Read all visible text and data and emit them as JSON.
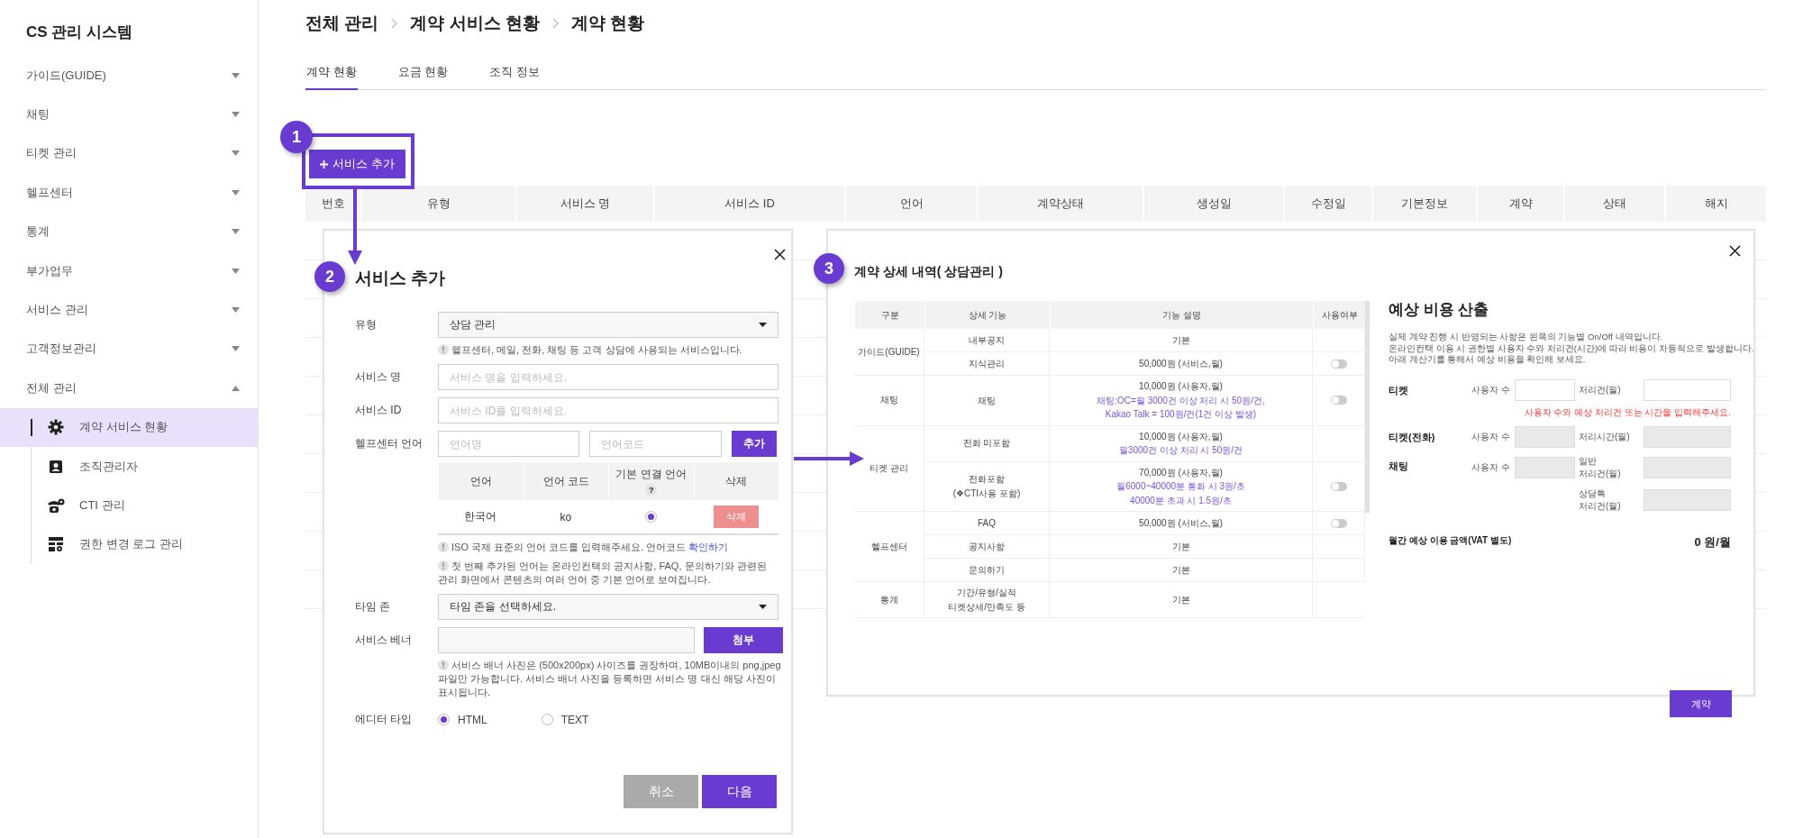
{
  "sidebar": {
    "title": "CS 관리 시스템",
    "items": [
      {
        "label": "가이드(GUIDE)",
        "expanded": false
      },
      {
        "label": "채팅",
        "expanded": false
      },
      {
        "label": "티켓 관리",
        "expanded": false
      },
      {
        "label": "헬프센터",
        "expanded": false
      },
      {
        "label": "통계",
        "expanded": false
      },
      {
        "label": "부가업무",
        "expanded": false
      },
      {
        "label": "서비스 관리",
        "expanded": false
      },
      {
        "label": "고객정보관리",
        "expanded": false
      },
      {
        "label": "전체 관리",
        "expanded": true,
        "children": [
          {
            "label": "계약 서비스 현황",
            "selected": true
          },
          {
            "label": "조직관리자",
            "selected": false
          },
          {
            "label": "CTI 관리",
            "selected": false
          },
          {
            "label": "권한 변경 로그 관리",
            "selected": false
          }
        ]
      }
    ]
  },
  "breadcrumb": [
    "전체 관리",
    "계약 서비스 현황",
    "계약 현황"
  ],
  "tabs": [
    {
      "label": "계약 현황",
      "selected": true
    },
    {
      "label": "요금 현황",
      "selected": false
    },
    {
      "label": "조직 정보",
      "selected": false
    }
  ],
  "add_button": "서비스 추가",
  "table": {
    "columns": [
      "번호",
      "유형",
      "서비스 명",
      "서비스 ID",
      "언어",
      "계약상태",
      "생성일",
      "수정일",
      "기본정보",
      "계약",
      "상태",
      "해지"
    ]
  },
  "callouts": [
    "1",
    "2",
    "3"
  ],
  "service_modal": {
    "title": "서비스 추가",
    "fields": [
      {
        "kind": "select",
        "label": "유형",
        "value": "상담 관리",
        "notes": [
          {
            "text": "헬프센터, 메일, 전화, 채팅 등 고객 상담에 사용되는 서비스입니다."
          }
        ]
      },
      {
        "kind": "text",
        "label": "서비스 명",
        "placeholder": "서비스 명을 입력하세요."
      },
      {
        "kind": "text",
        "label": "서비스 ID",
        "placeholder": "서비스 ID를 입력하세요."
      },
      {
        "kind": "language",
        "label": "헬프센터 언어",
        "name_placeholder": "언어명",
        "code_placeholder": "언어코드",
        "button": "추가",
        "columns": [
          "언어",
          "언어 코드",
          "기본 연결 언어",
          "삭제"
        ],
        "help_mark": "?",
        "rows": [
          {
            "language": "한국어",
            "code": "ko",
            "default": true,
            "delete": "삭제",
            "delete_disabled": true
          }
        ],
        "notes": [
          {
            "text": "ISO 국제 표준의 언어 코드를 입력해주세요. 언어코드",
            "link": "확인하기"
          },
          {
            "text": "첫 번째 추가된 언어는 온라인컨택의 공지사항, FAQ, 문의하기와 관련된 관리 화면에서 콘텐츠의 여러 언어 중 기본 언어로 보여집니다."
          }
        ]
      },
      {
        "kind": "select",
        "label": "타임 존",
        "value": "타임 존을 선택하세요."
      },
      {
        "kind": "file",
        "label": "서비스 베너",
        "button": "첨부",
        "notes": [
          {
            "text": "서비스 배너 사진은 (500x200px) 사이즈를 권장하며, 10MB이내의 png,jpeg 파일만 가능합니다. 서비스 배너 사진을 등록하면 서비스 명 대신 해당 사진이 표시됩니다."
          }
        ]
      },
      {
        "kind": "radio",
        "label": "에디터 타입",
        "options": [
          {
            "label": "HTML",
            "selected": true
          },
          {
            "label": "TEXT",
            "selected": false
          }
        ]
      }
    ],
    "buttons": [
      {
        "label": "취소",
        "kind": "secondary"
      },
      {
        "label": "다음",
        "kind": "primary"
      }
    ]
  },
  "contract_modal": {
    "title": "계약 상세 내역( 상담관리 )",
    "columns": [
      "구분",
      "상세 기능",
      "기능 설명",
      "사용여부"
    ],
    "groups": [
      {
        "category": "가이드(GUIDE)",
        "rows": [
          {
            "feature": [
              "내부공지"
            ],
            "price": "기본"
          },
          {
            "feature": [
              "지식관리"
            ],
            "price": "50,000원 (서비스,월)",
            "on": false
          }
        ]
      },
      {
        "category": "채팅",
        "rows": [
          {
            "feature": [
              "채팅"
            ],
            "price": "10,000원 (사용자,월)",
            "notes": [
              "채팅:OC=월 3000건 이상 처리 시 50원/건,",
              "Kakao Talk = 100원/건(1건 이상 발생)"
            ],
            "on": false
          }
        ]
      },
      {
        "category": "티켓 관리",
        "rows": [
          {
            "feature": [
              "전화 미포함"
            ],
            "price": "10,000원 (사용자,월)",
            "notes": [
              "월3000건 이상 처리 시 50원/건"
            ]
          },
          {
            "feature": [
              "전화포함",
              "(❖CTI사용 포함)"
            ],
            "price": "70,000원 (사용자,월)",
            "notes": [
              "월6000~40000분 통화 시 3원/초",
              "40000분 초과 시 1.5원/초"
            ],
            "on": false
          }
        ]
      },
      {
        "category": "헬프센터",
        "rows": [
          {
            "feature": [
              "FAQ"
            ],
            "price": "50,000원 (서비스,월)",
            "on": false
          },
          {
            "feature": [
              "공지사항"
            ],
            "price": "기본"
          },
          {
            "feature": [
              "문의하기"
            ],
            "price": "기본"
          }
        ]
      },
      {
        "category": "통계",
        "rows": [
          {
            "feature": [
              "기간/유형/실적",
              "티켓상세/만족도 등"
            ],
            "price": "기본"
          }
        ]
      }
    ],
    "calculator": {
      "title": "예상 비용 산출",
      "description": [
        "실제 계약 진행 시 반영되는 사항은 왼쪽의 기능별 On/Off 내역입니다.",
        "온라인컨택 이용 시 권한별 사용자 수와 처리건(시간)에 따라 비용이 차등적으로 발생합니다.",
        "아래 계산기를 통해서 예상 비용을 확인해 보세요."
      ],
      "rows": [
        {
          "category": "티켓",
          "inputs": [
            {
              "label": "사용자 수",
              "disabled": false
            },
            {
              "label": "처리건(월)",
              "disabled": false
            }
          ],
          "error": "사용자 수와 예상 처리건 또는 시간을 입력해주세요."
        },
        {
          "category": "티켓(전화)",
          "inputs": [
            {
              "label": "사용자 수",
              "disabled": true
            },
            {
              "label": "처리시간(월)",
              "disabled": true
            }
          ]
        },
        {
          "category": "채팅",
          "inputs": [
            {
              "label": "사용자 수",
              "disabled": true
            },
            {
              "label": "일반\n처리건(월)",
              "disabled": true
            },
            {
              "label": "상담톡\n처리건(월)",
              "disabled": true
            }
          ]
        }
      ],
      "total": {
        "label": "월간 예상 이용 금액(VAT 별도)",
        "value": "0 원/월"
      },
      "button": "계약"
    }
  }
}
